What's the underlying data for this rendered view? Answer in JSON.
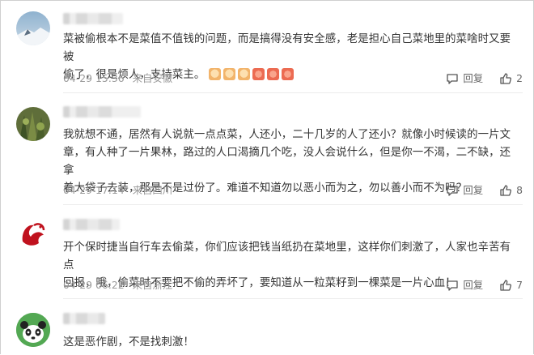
{
  "comments": [
    {
      "text_line1": "菜被偷根本不是菜值不值钱的问题，而是搞得没有安全感，老是担心自己菜地里的菜啥时又要被",
      "text_line2": "偷了，很是烦人，支持菜主。",
      "emojis": [
        "thumbs-up",
        "thumbs-up",
        "thumbs-up",
        "pray",
        "pray",
        "pray"
      ],
      "date": "04-29 15:36",
      "location": "来自安徽",
      "reply_label": "回复",
      "likes": "2"
    },
    {
      "text_line1": "我就想不通，居然有人说就一点点菜，人还小，二十几岁的人了还小？就像小时候读的一片文",
      "text_line2": "章，有人种了一片果林，路过的人口渴摘几个吃，没人会说什么，但是你一不渴，二不缺，还拿",
      "text_line3": "着大袋子去装，那是不是过份了。难道不知道勿以恶小而为之，勿以善小而不为吗？",
      "date": "04-29 17:14",
      "location": "来自四川",
      "reply_label": "回复",
      "likes": "8"
    },
    {
      "text_line1": "开个保时捷当自行车去偷菜，你们应该把钱当纸扔在菜地里，这样你们刺激了，人家也辛苦有点",
      "text_line2": "回报，哦，偷菜时不要把不偷的弄坏了，要知道从一粒菜籽到一棵菜是一片心血！",
      "date": "04-29 06:22",
      "location": "来自浙江",
      "reply_label": "回复",
      "likes": "7"
    },
    {
      "text_line1": "这是恶作剧，不是找刺激！"
    }
  ]
}
